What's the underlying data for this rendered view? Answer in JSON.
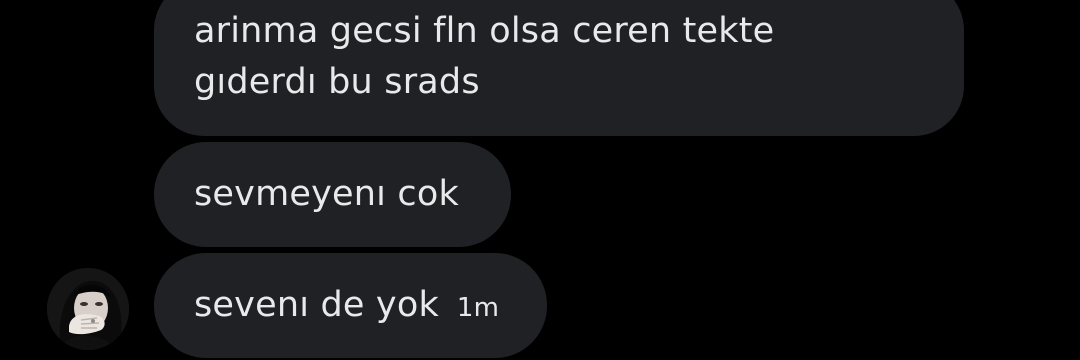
{
  "messages": [
    {
      "lines": [
        "arinma gecsi fln olsa ceren tekte",
        "gıderdı bu srads"
      ]
    },
    {
      "lines": [
        "sevmeyenı cok"
      ]
    },
    {
      "lines": [
        "sevenı de yok"
      ],
      "time": "1m"
    }
  ],
  "colors": {
    "background": "#000000",
    "bubble": "#202124",
    "text": "#e7e9ea"
  }
}
